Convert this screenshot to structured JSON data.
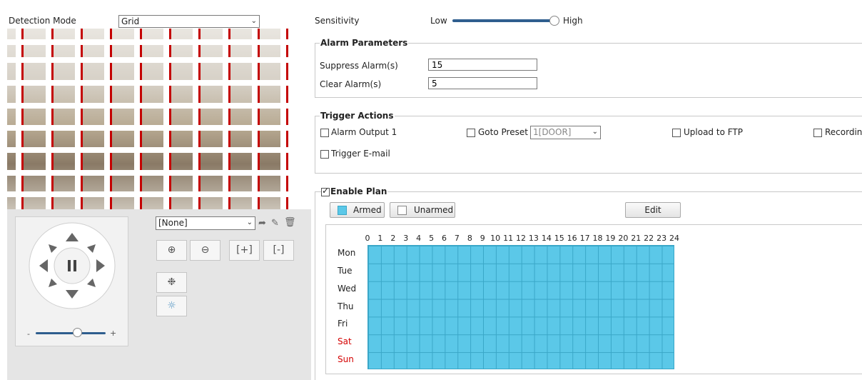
{
  "detection": {
    "label": "Detection Mode",
    "mode": "Grid"
  },
  "sensitivity": {
    "label": "Sensitivity",
    "low": "Low",
    "high": "High",
    "level": 0.97
  },
  "alarm_params": {
    "title": "Alarm Parameters",
    "suppress_label": "Suppress Alarm(s)",
    "suppress_value": "15",
    "clear_label": "Clear Alarm(s)",
    "clear_value": "5"
  },
  "trigger": {
    "title": "Trigger Actions",
    "alarm_output": "Alarm Output 1",
    "goto_preset": "Goto Preset",
    "preset_value": "1[DOOR]",
    "upload_ftp": "Upload to FTP",
    "recording": "Recording",
    "email": "Trigger E-mail"
  },
  "plan": {
    "enable_label": "Enable Plan",
    "armed": "Armed",
    "unarmed": "Unarmed",
    "edit": "Edit",
    "hours": [
      "0",
      "1",
      "2",
      "3",
      "4",
      "5",
      "6",
      "7",
      "8",
      "9",
      "10",
      "11",
      "12",
      "13",
      "14",
      "15",
      "16",
      "17",
      "18",
      "19",
      "20",
      "21",
      "22",
      "23",
      "24"
    ],
    "days": [
      "Mon",
      "Tue",
      "Wed",
      "Thu",
      "Fri",
      "Sat",
      "Sun"
    ],
    "armed_color": "#5bc8e8",
    "weekend_color": "#d40000"
  },
  "ptz": {
    "preset_select": "[None]"
  },
  "icons": [
    "chevron-down-icon",
    "pan-up-icon",
    "pan-down-icon",
    "pan-left-icon",
    "pan-right-icon",
    "pause-icon",
    "zoom-in-icon",
    "zoom-out-icon",
    "focus-near-icon",
    "focus-far-icon",
    "wiper-icon",
    "light-icon",
    "go-icon",
    "edit-icon",
    "delete-icon"
  ]
}
